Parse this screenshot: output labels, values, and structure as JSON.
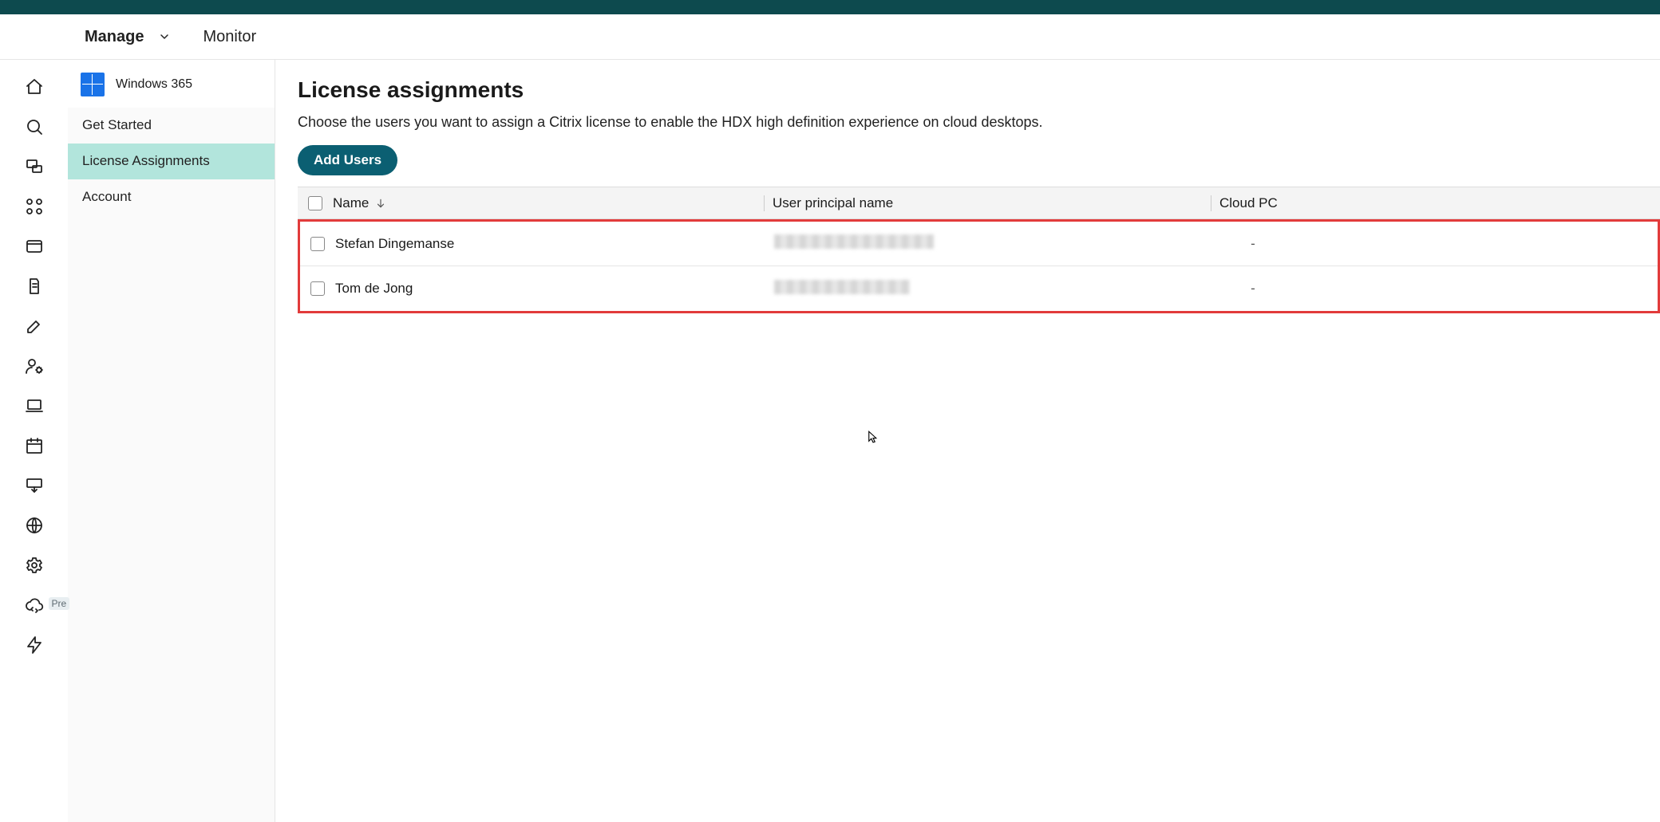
{
  "tabs": {
    "manage": "Manage",
    "monitor": "Monitor"
  },
  "subnav": {
    "title": "Windows 365",
    "items": [
      "Get Started",
      "License Assignments",
      "Account"
    ],
    "active_index": 1
  },
  "iconrail_badge": "Pre",
  "page": {
    "title": "License assignments",
    "description": "Choose the users you want to assign a Citrix license to enable the HDX high definition experience on cloud desktops.",
    "add_button": "Add Users"
  },
  "table": {
    "columns": {
      "name": "Name",
      "upn": "User principal name",
      "cloudpc": "Cloud PC"
    },
    "rows": [
      {
        "name": "Stefan Dingemanse",
        "upn_redacted": true,
        "cloudpc": "-"
      },
      {
        "name": "Tom de Jong",
        "upn_redacted": true,
        "cloudpc": "-"
      }
    ]
  }
}
